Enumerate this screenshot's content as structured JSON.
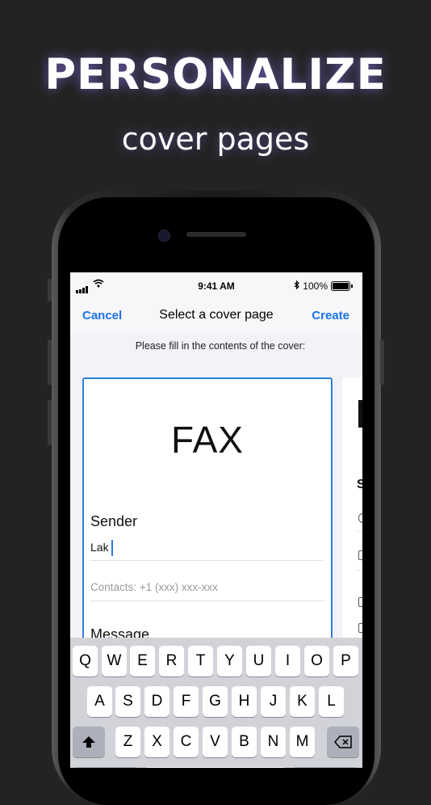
{
  "promo": {
    "headline": "PERSONALIZE",
    "subline": "cover pages"
  },
  "status_bar": {
    "time": "9:41 AM",
    "battery": "100%",
    "wifi_icon": "wifi-icon",
    "bluetooth_icon": "bluetooth-icon"
  },
  "nav": {
    "cancel": "Cancel",
    "title": "Select a cover page",
    "create": "Create"
  },
  "instruction": "Please fill in the contents of the cover:",
  "cover": {
    "title": "FAX",
    "sender_label": "Sender",
    "sender_value": "Lak",
    "contacts_placeholder": "Contacts: +1 (xxx) xxx-xxx",
    "message_label": "Message"
  },
  "next_cover": {
    "partial_letter": "S"
  },
  "keyboard": {
    "row1": [
      "Q",
      "W",
      "E",
      "R",
      "T",
      "Y",
      "U",
      "I",
      "O",
      "P"
    ],
    "row2": [
      "A",
      "S",
      "D",
      "F",
      "G",
      "H",
      "J",
      "K",
      "L"
    ],
    "row3": [
      "Z",
      "X",
      "C",
      "V",
      "B",
      "N",
      "M"
    ],
    "shift_icon": "shift-icon",
    "delete_icon": "delete-icon"
  },
  "colors": {
    "accent": "#1a73e8",
    "card_border": "#2f7de1",
    "background": "#232323"
  }
}
